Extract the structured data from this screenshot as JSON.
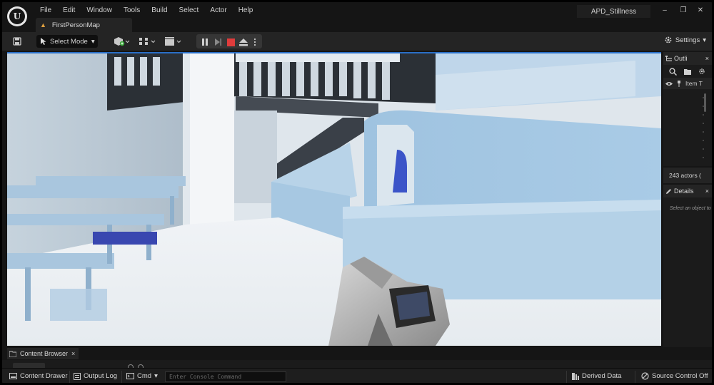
{
  "window": {
    "menu": [
      "File",
      "Edit",
      "Window",
      "Tools",
      "Build",
      "Select",
      "Actor",
      "Help"
    ],
    "project_name": "APD_Stillness",
    "controls": {
      "minimize": "–",
      "restore": "❐",
      "close": "✕"
    }
  },
  "tabs": {
    "map": "FirstPersonMap"
  },
  "toolbar": {
    "select_mode": "Select Mode",
    "settings": "Settings",
    "chevron": "▾"
  },
  "outliner": {
    "tab_label": "Outli",
    "close": "×",
    "column_label": "Item T",
    "actor_count": "243 actors ("
  },
  "details": {
    "tab_label": "Details",
    "close": "×",
    "empty_text": "Select an object to"
  },
  "content_browser": {
    "tab_label": "Content Browser",
    "close": "×"
  },
  "statusbar": {
    "content_drawer": "Content Drawer",
    "output_log": "Output Log",
    "cmd": "Cmd",
    "console_placeholder": "Enter Console Command",
    "derived_data": "Derived Data",
    "source_control": "Source Control Off"
  },
  "colors": {
    "accent_blue": "#2a6fc7",
    "stop_red": "#e03c3c",
    "map_icon": "#e0a040"
  }
}
